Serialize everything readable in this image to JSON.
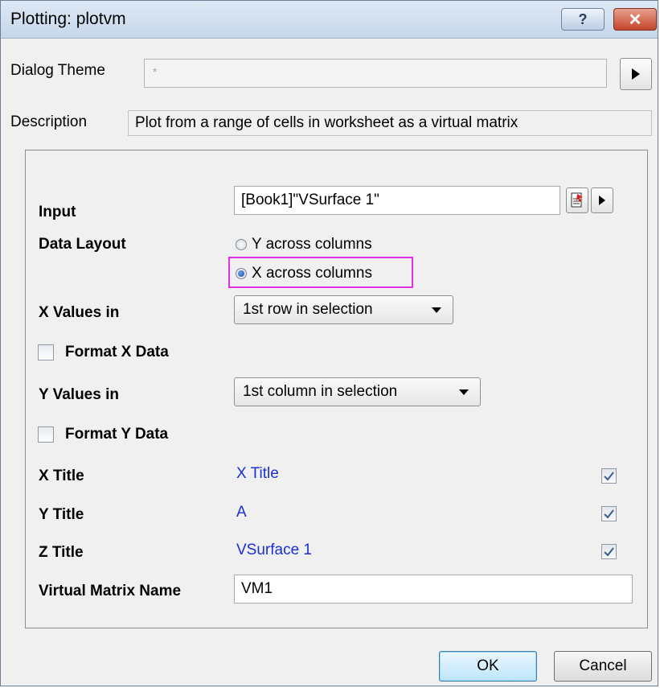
{
  "window": {
    "title": "Plotting: plotvm",
    "help_label": "?",
    "close_label": "✕"
  },
  "dialog_theme": {
    "label": "Dialog Theme",
    "value": "*"
  },
  "description": {
    "label": "Description",
    "value": "Plot from a range of cells in worksheet as a virtual matrix"
  },
  "input": {
    "label": "Input",
    "value": "[Book1]\"VSurface 1\""
  },
  "data_layout": {
    "label": "Data Layout",
    "options": [
      "Y across columns",
      "X across columns"
    ],
    "selected": "X across columns"
  },
  "x_values_in": {
    "label": "X Values in",
    "value": "1st row in selection"
  },
  "format_x": {
    "label": "Format X Data",
    "checked": false
  },
  "y_values_in": {
    "label": "Y Values in",
    "value": "1st column in selection"
  },
  "format_y": {
    "label": "Format Y Data",
    "checked": false
  },
  "x_title": {
    "label": "X Title",
    "value": "X Title",
    "checked": true
  },
  "y_title": {
    "label": "Y Title",
    "value": "A",
    "checked": true
  },
  "z_title": {
    "label": "Z Title",
    "value": "VSurface 1",
    "checked": true
  },
  "vm_name": {
    "label": "Virtual Matrix Name",
    "value": "VM1"
  },
  "buttons": {
    "ok": "OK",
    "cancel": "Cancel"
  },
  "colors": {
    "link_blue": "#1a2fd6",
    "highlight": "#e030e0"
  }
}
